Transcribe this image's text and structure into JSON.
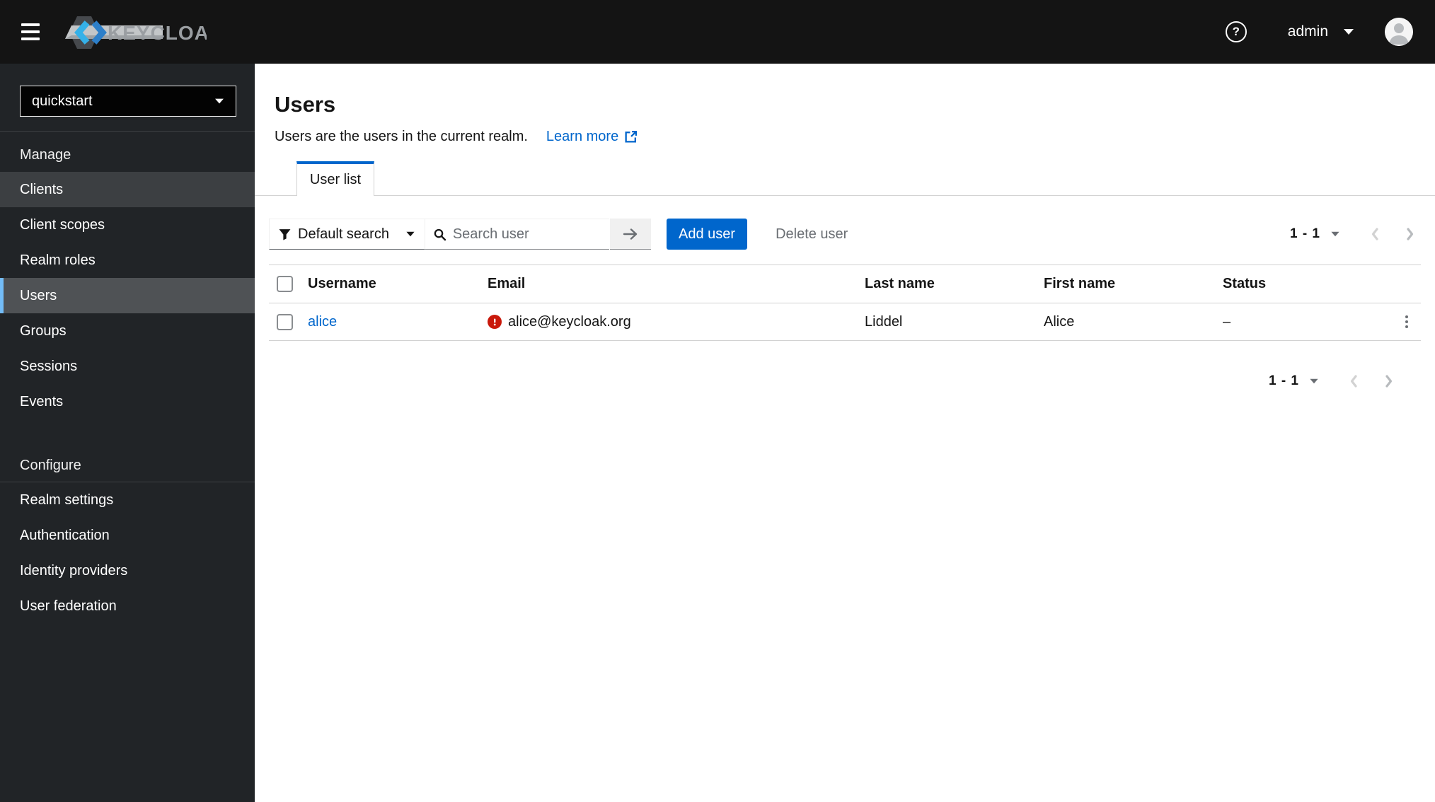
{
  "header": {
    "brand": "KEYCLOAK",
    "help_glyph": "?",
    "user_menu": "admin"
  },
  "sidebar": {
    "realm": "quickstart",
    "selected_item": "Users",
    "sections": [
      {
        "label": "Manage",
        "items": [
          {
            "label": "Clients"
          },
          {
            "label": "Client scopes"
          },
          {
            "label": "Realm roles"
          },
          {
            "label": "Users"
          },
          {
            "label": "Groups"
          },
          {
            "label": "Sessions"
          },
          {
            "label": "Events"
          }
        ]
      },
      {
        "label": "Configure",
        "items": [
          {
            "label": "Realm settings"
          },
          {
            "label": "Authentication"
          },
          {
            "label": "Identity providers"
          },
          {
            "label": "User federation"
          }
        ]
      }
    ]
  },
  "main": {
    "title": "Users",
    "subtitle": "Users are the users in the current realm.",
    "learn_more": "Learn more",
    "tab": "User list",
    "toolbar": {
      "filter_label": "Default search",
      "search_placeholder": "Search user",
      "add_user": "Add user",
      "delete_user": "Delete user"
    },
    "pagination_top": {
      "range": "1 - 1"
    },
    "pagination_bottom": {
      "range": "1 - 1"
    },
    "table": {
      "columns": [
        "Username",
        "Email",
        "Last name",
        "First name",
        "Status"
      ],
      "rows": [
        {
          "username": "alice",
          "email": "alice@keycloak.org",
          "email_invalid": true,
          "last_name": "Liddel",
          "first_name": "Alice",
          "status": "–"
        }
      ]
    }
  },
  "colors": {
    "accent": "#0066cc",
    "danger": "#c9190b",
    "nav_selected_indicator": "#73bcf7",
    "masthead": "#141414",
    "sidebar": "#212427"
  }
}
